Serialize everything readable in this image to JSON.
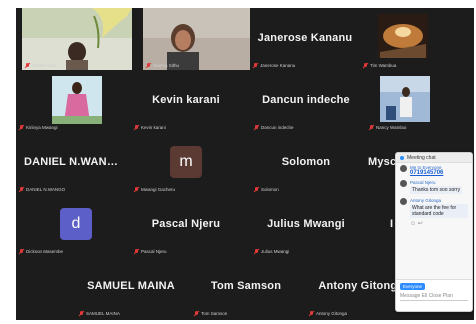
{
  "tiles": [
    {
      "id": "t1",
      "type": "video",
      "name": "",
      "label": "Scoller Catu",
      "active": true
    },
    {
      "id": "t2",
      "type": "video",
      "name": "",
      "label": "Neema Sithu"
    },
    {
      "id": "t3",
      "type": "name",
      "name": "Janerose Kananu",
      "label": "Janerose Kananu"
    },
    {
      "id": "t4",
      "type": "video",
      "name": "",
      "label": "Tim Wambua"
    },
    {
      "id": "t5",
      "type": "video",
      "name": "",
      "label": "Kiriinya Mwangi"
    },
    {
      "id": "t6",
      "type": "name",
      "name": "Kevin karani",
      "label": "Kevin karani"
    },
    {
      "id": "t7",
      "type": "name",
      "name": "Dancun indeche",
      "label": "Dancun indeche"
    },
    {
      "id": "t8",
      "type": "video",
      "name": "",
      "label": "Nancy Wambui"
    },
    {
      "id": "t9",
      "type": "name",
      "name": "DANIEL  N.WAN…",
      "label": "DANIEL N.WANGO"
    },
    {
      "id": "t10",
      "type": "letter",
      "name": "m",
      "label": "Mwangi Gacheru",
      "color": "#5a3a32"
    },
    {
      "id": "t11",
      "type": "name",
      "name": "Solomon",
      "label": "Solomon"
    },
    {
      "id": "t12",
      "type": "name",
      "name": "Mysc",
      "label": "Myscelia"
    },
    {
      "id": "t13",
      "type": "letter",
      "name": "d",
      "label": "Dickson Masembe",
      "color": "#5b5fc7"
    },
    {
      "id": "t14",
      "type": "name",
      "name": "Pascal Njeru",
      "label": "Pascal Njeru"
    },
    {
      "id": "t15",
      "type": "name",
      "name": "Julius Mwangi",
      "label": "Julius Mwangi"
    },
    {
      "id": "t16",
      "type": "name",
      "name": "I",
      "label": "Irene"
    },
    {
      "id": "t17",
      "type": "name",
      "name": "SAMUEL MAINA",
      "label": "SAMUEL MAINA"
    },
    {
      "id": "t18",
      "type": "name",
      "name": "Tom Samson",
      "label": "Tom Samson"
    },
    {
      "id": "t19",
      "type": "name",
      "name": "Antony Gitonga",
      "label": "Antony Gitonga"
    }
  ],
  "chat": {
    "title": "Meeting chat",
    "messages": [
      {
        "who": "Me to Everyone",
        "text": "0719145706",
        "link": true
      },
      {
        "who": "Pascal Njeru",
        "text": "Thanks tom soo sorry"
      },
      {
        "who": "Antony Gitonga",
        "text": "What are the fee for standard code"
      }
    ],
    "emoji_row": "☺  ↩",
    "to_label": "Everyone",
    "input_placeholder": "Message Ell Close Plan"
  },
  "colors": {
    "background": "#1c1c1c",
    "active_speaker": "#4fc35a",
    "muted_mic": "#e03a3a",
    "chat_link": "#1a5fd8"
  }
}
